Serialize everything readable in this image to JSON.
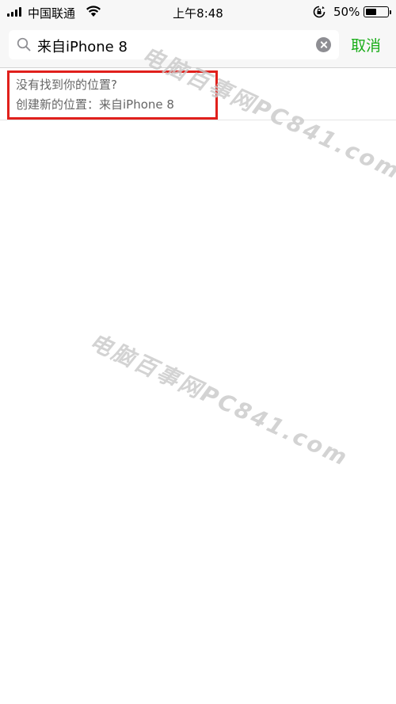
{
  "status_bar": {
    "carrier": "中国联通",
    "time": "上午8:48",
    "battery_percent": "50%",
    "battery_level": 0.5
  },
  "search": {
    "query": "来自iPhone 8",
    "cancel_label": "取消"
  },
  "results": {
    "not_found_text": "没有找到你的位置?",
    "create_text": "创建新的位置：来自iPhone 8"
  },
  "watermark": {
    "text": "电脑百事网PC841.com"
  },
  "colors": {
    "accent": "#1aad19",
    "highlight_border": "#e0201c"
  }
}
